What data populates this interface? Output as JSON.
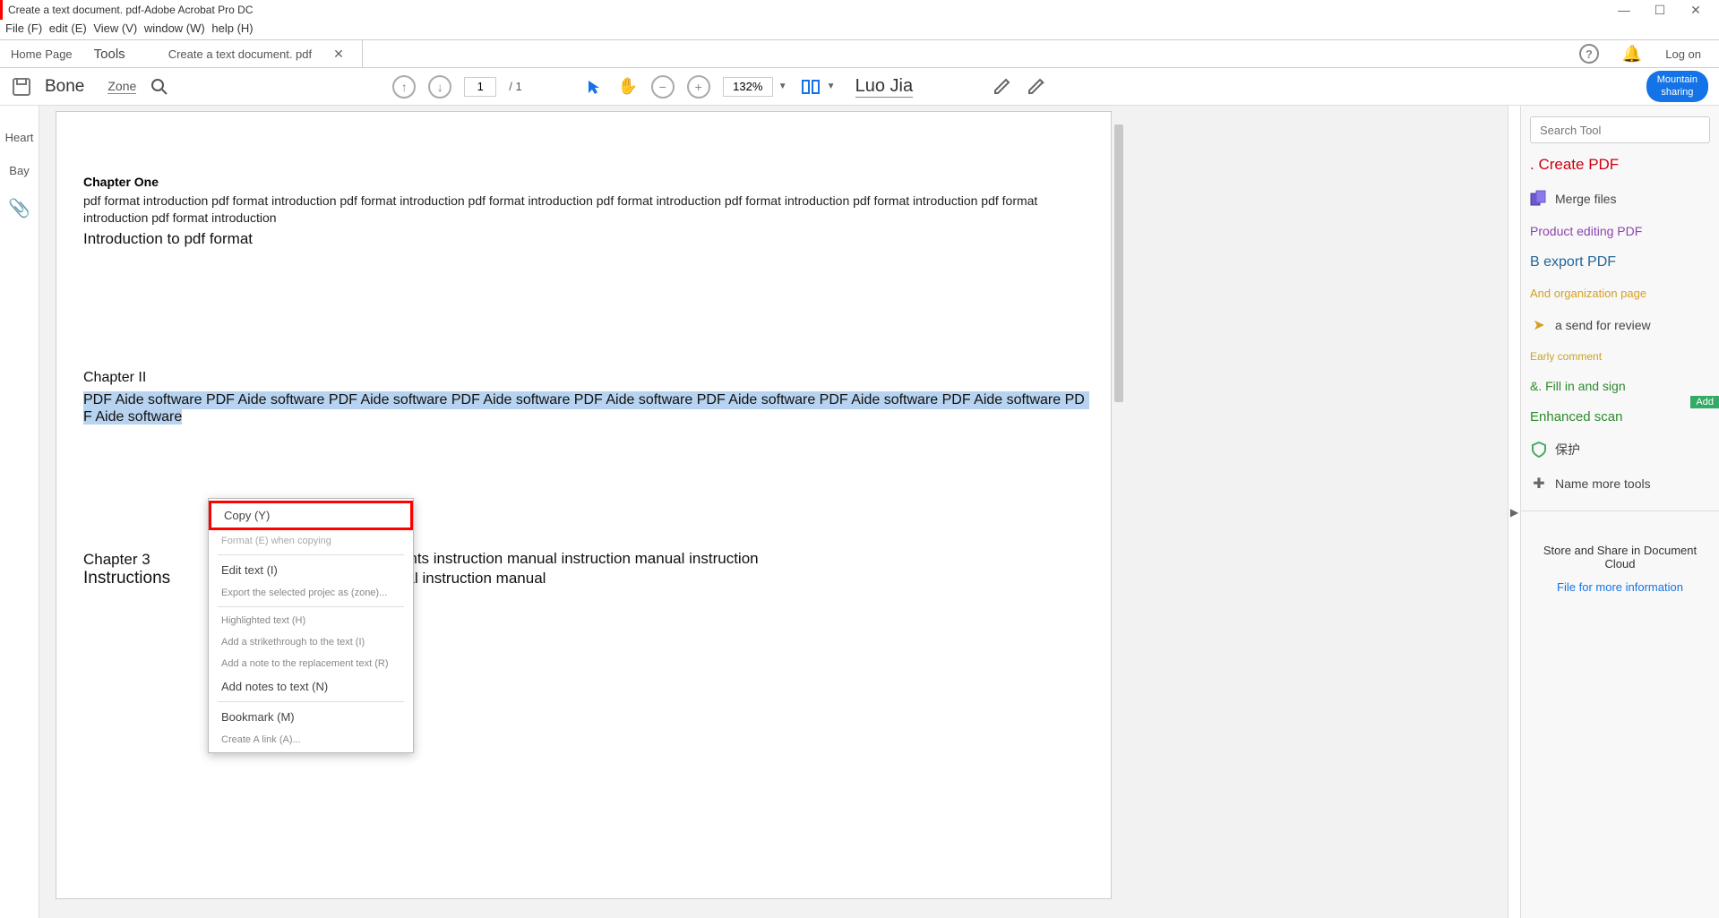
{
  "titlebar": {
    "title": "Create a text document. pdf-Adobe Acrobat Pro DC"
  },
  "menubar": {
    "file": "File (F)",
    "edit": "edit (E)",
    "view": "View (V)",
    "window": "window (W)",
    "help": "help (H)"
  },
  "tabs": {
    "home": "Home Page",
    "tools": "Tools",
    "doc": "Create a text document. pdf",
    "logon": "Log on"
  },
  "toolbar": {
    "bone": "Bone",
    "zone": "Zone",
    "page_current": "1",
    "page_total": "/ 1",
    "zoom": "132%",
    "luojia": "Luo Jia",
    "share_top": "Mountain",
    "share_bot": "sharing"
  },
  "leftrail": {
    "heart": "Heart",
    "bay": "Bay"
  },
  "document": {
    "ch1": "Chapter One",
    "ch1_body": "pdf format introduction pdf format introduction pdf format introduction pdf format introduction pdf format introduction pdf format introduction pdf format introduction pdf format introduction pdf format introduction",
    "ch1_big": "Introduction to pdf format",
    "ch2": "Chapter II",
    "ch2_sel": "PDF Aide software PDF Aide software PDF Aide software PDF Aide software PDF Aide software PDF Aide software PDF Aide software PDF Aide software PD",
    "ch2_sel2": "F Aide software",
    "ch3": "Chapter 3",
    "instr": "Instructions",
    "contents": "Contents instruction manual instruction manual instruction manual instruction manual"
  },
  "context_menu": {
    "copy": "Copy (Y)",
    "format_copy": "Format (E) when copying",
    "edit_text": "Edit text (I)",
    "export_sel": "Export the selected projec as (zone)...",
    "highlight": "Highlighted text (H)",
    "strikethrough": "Add a strikethrough to the text (I)",
    "replace_note": "Add a note to the replacement text (R)",
    "add_notes": "Add notes to text (N)",
    "bookmark": "Bookmark (M)",
    "create_link": "Create A link (A)..."
  },
  "rightrail": {
    "search_placeholder": "Search Tool",
    "create_pdf": ". Create PDF",
    "merge": "Merge files",
    "product_edit": "Product editing PDF",
    "export": "B export PDF",
    "organize": "And organization page",
    "send_review": "a send for review",
    "early_comment": "Early comment",
    "fill_sign": "&. Fill in and sign",
    "enhanced_scan": "Enhanced scan",
    "protect": "保护",
    "more_tools": "Name more tools",
    "add_badge": "Add",
    "cloud_title": "Store and Share in Document Cloud",
    "cloud_sub": "File for more information"
  }
}
